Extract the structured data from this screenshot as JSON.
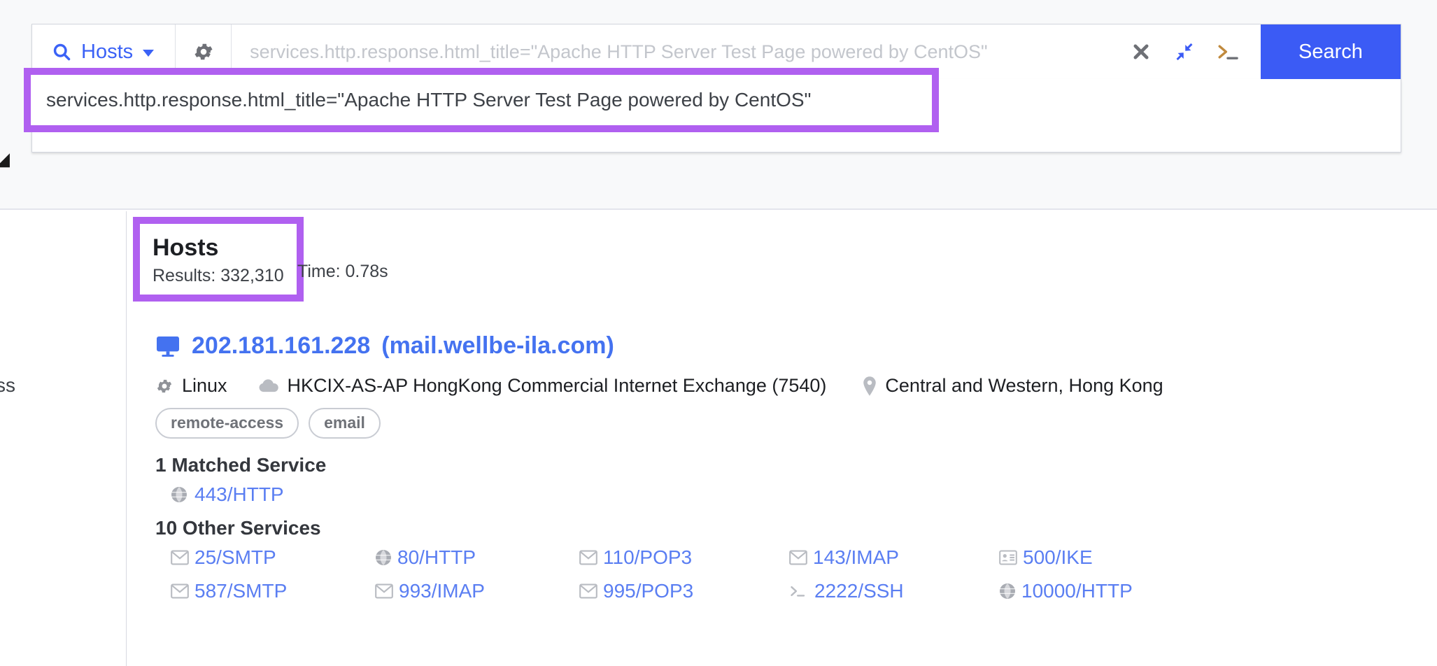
{
  "search": {
    "scope_label": "Hosts",
    "scope_icon": "search-icon",
    "settings_icon": "gear-icon",
    "query_value": "services.http.response.html_title=\"Apache HTTP Server Test Page powered by CentOS\"",
    "query_placeholder": "services.http.response.html_title=\"Apache HTTP Server Test Page powered by CentOS\"",
    "clear_icon": "close-icon",
    "collapse_icon": "collapse-arrows-icon",
    "console_icon": "terminal-icon",
    "search_button_label": "Search",
    "accent_color": "#3b5bf5",
    "suggestion": "services.http.response.html_title=\"Apache HTTP Server Test Page powered by CentOS\"",
    "highlight_color": "#b060f0"
  },
  "edge": {
    "chevron": "◢",
    "cut_text": "ss"
  },
  "results": {
    "title": "Hosts",
    "results_label": "Results: 332,310",
    "time_label": "Time: 0.78s"
  },
  "host": {
    "device_icon": "desktop-icon",
    "ip": "202.181.161.228",
    "hostname": "(mail.wellbe-ila.com)",
    "os_icon": "gear-icon",
    "os": "Linux",
    "network_icon": "cloud-icon",
    "network": "HKCIX-AS-AP HongKong Commercial Internet Exchange (7540)",
    "location_icon": "map-pin-icon",
    "location": "Central and Western, Hong Kong",
    "tags": [
      "remote-access",
      "email"
    ],
    "matched_heading": "1 Matched Service",
    "matched_services": [
      {
        "icon": "globe-icon",
        "label": "443/HTTP"
      }
    ],
    "other_heading": "10 Other Services",
    "other_services": [
      {
        "icon": "envelope-icon",
        "label": "25/SMTP"
      },
      {
        "icon": "globe-icon",
        "label": "80/HTTP"
      },
      {
        "icon": "envelope-icon",
        "label": "110/POP3"
      },
      {
        "icon": "envelope-icon",
        "label": "143/IMAP"
      },
      {
        "icon": "id-card-icon",
        "label": "500/IKE"
      },
      {
        "icon": "envelope-icon",
        "label": "587/SMTP"
      },
      {
        "icon": "envelope-icon",
        "label": "993/IMAP"
      },
      {
        "icon": "envelope-icon",
        "label": "995/POP3"
      },
      {
        "icon": "terminal-icon",
        "label": "2222/SSH"
      },
      {
        "icon": "globe-icon",
        "label": "10000/HTTP"
      }
    ]
  }
}
